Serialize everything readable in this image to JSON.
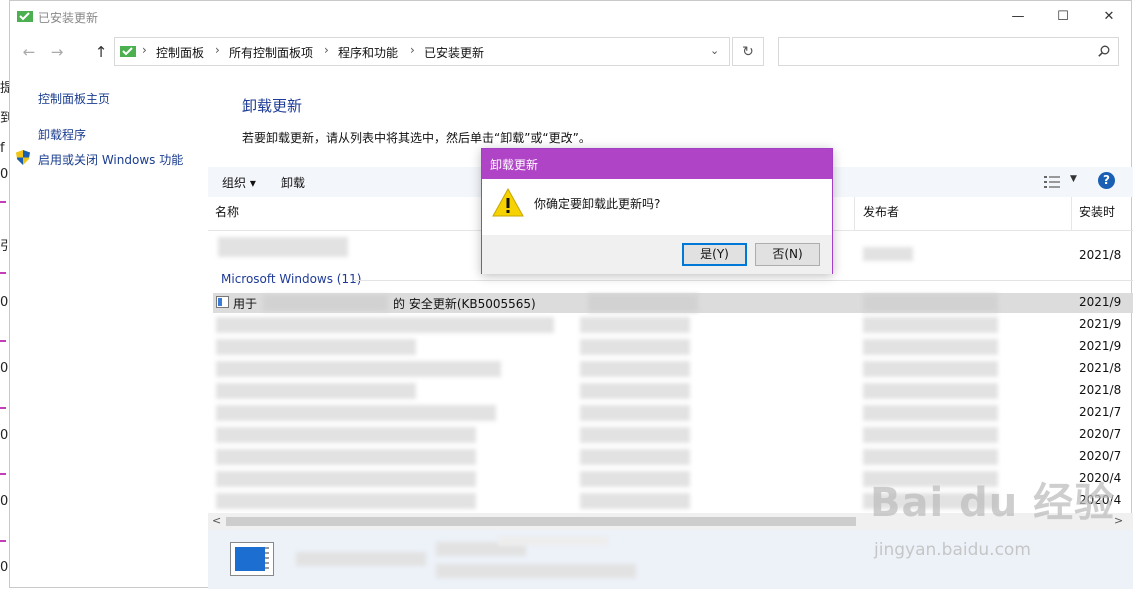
{
  "window": {
    "title": "已安装更新",
    "controls": {
      "minimize": "—",
      "maximize": "☐",
      "close": "✕"
    }
  },
  "nav": {
    "back": "←",
    "forward": "→",
    "up": "↑",
    "breadcrumbs": [
      "控制面板",
      "所有控制面板项",
      "程序和功能",
      "已安装更新"
    ],
    "separator": "›",
    "dropdown": "⌄",
    "refresh": "↻",
    "search_placeholder": ""
  },
  "leftpane": {
    "links": [
      {
        "label": "控制面板主页"
      },
      {
        "label": "卸载程序"
      },
      {
        "label": "启用或关闭 Windows 功能"
      }
    ]
  },
  "main": {
    "heading": "卸载更新",
    "description": "若要卸载更新，请从列表中将其选中，然后单击“卸载”或“更改”。",
    "toolbar": {
      "organize": "组织 ▾",
      "uninstall": "卸载",
      "help": "?"
    },
    "columns": {
      "name": "名称",
      "publisher": "发布者",
      "installed_on": "安装时"
    },
    "group_label": "Microsoft Windows (11)",
    "selected_row": {
      "prefix": "用于",
      "name": "的 安全更新(KB5005565)"
    },
    "dates": [
      "2021/8",
      "2021/9",
      "2021/9",
      "2021/9",
      "2021/8",
      "2021/8",
      "2021/7",
      "2020/7",
      "2020/7",
      "2020/4",
      "2020/4"
    ]
  },
  "dialog": {
    "title": "卸载更新",
    "message": "你确定要卸载此更新吗?",
    "yes": "是(Y)",
    "no": "否(N)"
  },
  "strip": {
    "glyphs": [
      "提",
      "到",
      "f",
      "0",
      "引",
      "0",
      "0",
      "0",
      "0",
      "0"
    ]
  },
  "watermark": {
    "logo": "Bai du 经验",
    "url": "jingyan.baidu.com"
  },
  "colors": {
    "dialog_title": "#b044c6",
    "link": "#1a3d8f",
    "heading": "#1e3b96"
  }
}
